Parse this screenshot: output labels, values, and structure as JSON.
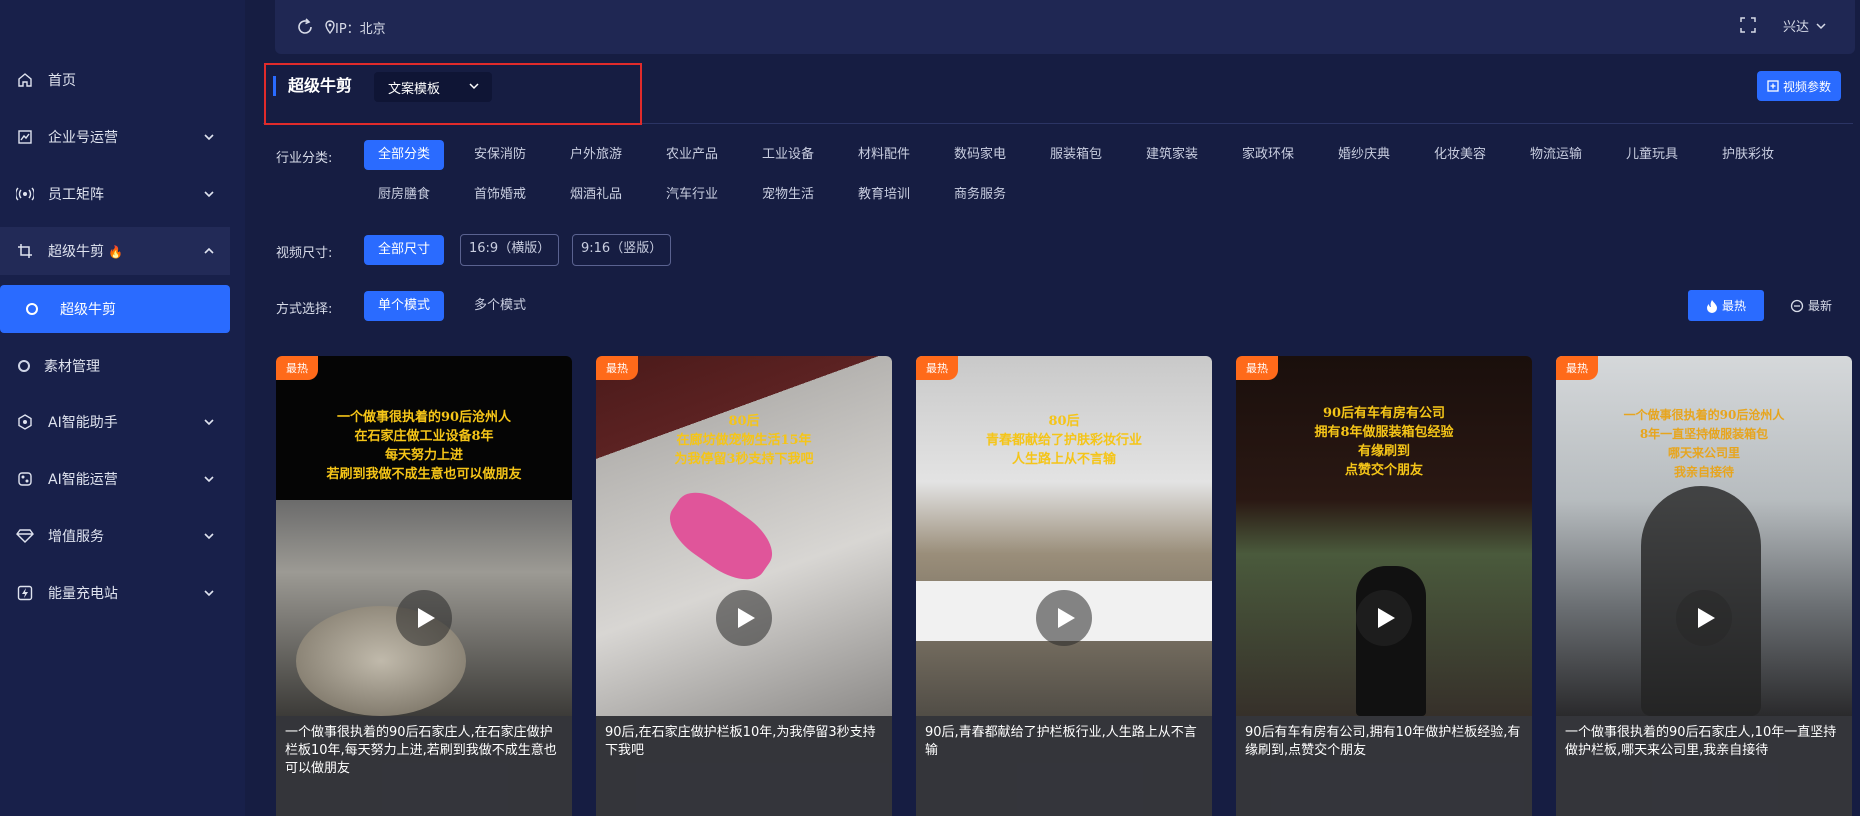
{
  "topbar": {
    "ip_label": "IP：北京",
    "user_name": "兴达"
  },
  "sidebar": {
    "items": [
      {
        "label": "首页",
        "icon": "home-icon"
      },
      {
        "label": "企业号运营",
        "icon": "chart-icon"
      },
      {
        "label": "员工矩阵",
        "icon": "broadcast-icon"
      },
      {
        "label": "超级牛剪",
        "icon": "crop-icon"
      },
      {
        "label": "超级牛剪",
        "icon": "circle-icon"
      },
      {
        "label": "素材管理",
        "icon": "circle-icon"
      },
      {
        "label": "AI智能助手",
        "icon": "ai-icon"
      },
      {
        "label": "AI智能运营",
        "icon": "ai-ops-icon"
      },
      {
        "label": "增值服务",
        "icon": "diamond-icon"
      },
      {
        "label": "能量充电站",
        "icon": "lightning-icon"
      }
    ]
  },
  "header": {
    "title": "超级牛剪",
    "template_select": "文案模板",
    "video_params_button": "视频参数"
  },
  "filters": {
    "industry_label": "行业分类:",
    "industries": [
      "全部分类",
      "安保消防",
      "户外旅游",
      "农业产品",
      "工业设备",
      "材料配件",
      "数码家电",
      "服装箱包",
      "建筑家装",
      "家政环保",
      "婚纱庆典",
      "化妆美容",
      "物流运输",
      "儿童玩具",
      "护肤彩妆",
      "厨房膳食",
      "首饰婚戒",
      "烟酒礼品",
      "汽车行业",
      "宠物生活",
      "教育培训",
      "商务服务"
    ],
    "size_label": "视频尺寸:",
    "sizes": [
      "全部尺寸",
      "16:9（横版）",
      "9:16（竖版）"
    ],
    "mode_label": "方式选择:",
    "modes": [
      "单个模式",
      "多个模式"
    ],
    "sort_hot": "最热",
    "sort_new": "最新"
  },
  "cards": [
    {
      "badge": "最热",
      "overlay": "一个做事很执着的90后沧州人\n在石家庄做工业设备8年\n每天努力上进\n若刷到我做不成生意也可以做朋友",
      "caption": "一个做事很执着的90后石家庄人,在石家庄做护栏板10年,每天努力上进,若刷到我做不成生意也可以做朋友"
    },
    {
      "badge": "最热",
      "overlay": "80后\n在廊坊做宠物生活15年\n为我停留3秒支持下我吧",
      "caption": "90后,在石家庄做护栏板10年,为我停留3秒支持下我吧"
    },
    {
      "badge": "最热",
      "overlay": "80后\n青春都献给了护肤彩妆行业\n人生路上从不言输",
      "caption": "90后,青春都献给了护栏板行业,人生路上从不言输"
    },
    {
      "badge": "最热",
      "overlay": "90后有车有房有公司\n拥有8年做服装箱包经验\n有缘刷到\n点赞交个朋友",
      "caption": "90后有车有房有公司,拥有10年做护栏板经验,有缘刷到,点赞交个朋友"
    },
    {
      "badge": "最热",
      "overlay": "一个做事很执着的90后沧州人\n8年一直坚持做服装箱包\n哪天来公司里\n我亲自接待",
      "caption": "一个做事很执着的90后石家庄人,10年一直坚持做护栏板,哪天来公司里,我亲自接待"
    }
  ],
  "colors": {
    "accent": "#2a6bff",
    "hot_badge": "#ff6a1a",
    "highlight": "#e02b2b",
    "overlay_text": "#f5c518"
  }
}
